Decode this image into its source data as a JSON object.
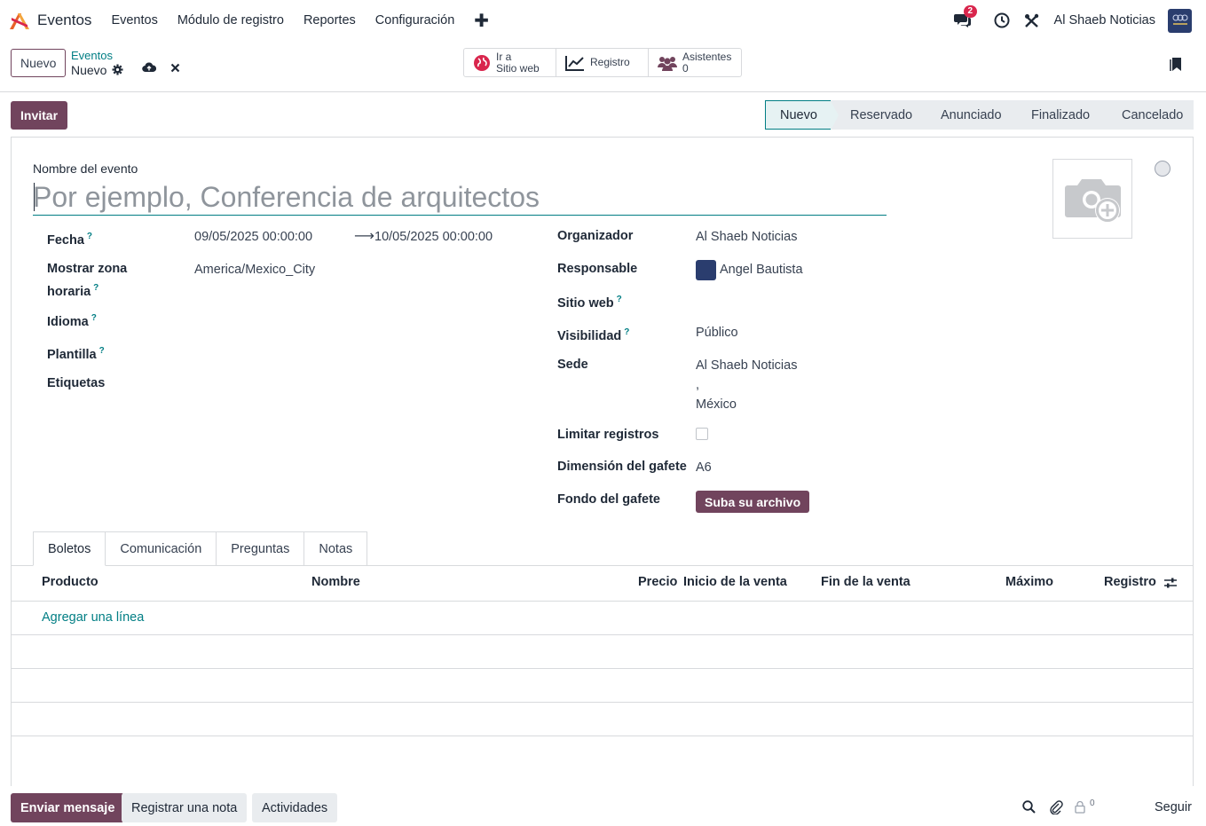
{
  "app": {
    "name": "Eventos"
  },
  "menu": {
    "items": [
      "Eventos",
      "Módulo de registro",
      "Reportes",
      "Configuración"
    ],
    "plus": "✚"
  },
  "navbar": {
    "messages_badge": "2",
    "company": "Al Shaeb Noticias"
  },
  "control": {
    "new_label": "Nuevo",
    "breadcrumb_parent": "Eventos",
    "breadcrumb_current": "Nuevo",
    "smart_buttons": {
      "website_line1": "Ir a",
      "website_line2": "Sitio web",
      "registration": "Registro",
      "attendees_label": "Asistentes",
      "attendees_count": "0"
    }
  },
  "statusbar": {
    "invite_label": "Invitar",
    "stages": [
      "Nuevo",
      "Reservado",
      "Anunciado",
      "Finalizado",
      "Cancelado"
    ],
    "active_stage": "Nuevo"
  },
  "form": {
    "event_name_label": "Nombre del evento",
    "event_name_placeholder": "Por ejemplo, Conferencia de arquitectos",
    "date_label": "Fecha",
    "date_start": "09/05/2025 00:00:00",
    "date_arrow": "⟶",
    "date_end": "10/05/2025 00:00:00",
    "timezone_label_line1": "Mostrar zona",
    "timezone_label_line2": "horaria",
    "timezone_value": "America/Mexico_City",
    "language_label": "Idioma",
    "template_label": "Plantilla",
    "tags_label": "Etiquetas",
    "organizer_label": "Organizador",
    "organizer_value": "Al Shaeb Noticias",
    "responsible_label": "Responsable",
    "responsible_value": "Angel Bautista",
    "website_label": "Sitio web",
    "visibility_label": "Visibilidad",
    "visibility_value": "Público",
    "venue_label": "Sede",
    "venue_line1": "Al Shaeb Noticias",
    "venue_line2": ",",
    "venue_line3": "México",
    "limit_label": "Limitar registros",
    "limit_checked": false,
    "badge_size_label": "Dimensión del gafete",
    "badge_size_value": "A6",
    "badge_bg_label": "Fondo del gafete",
    "upload_label": "Suba su archivo",
    "help_mark": "?"
  },
  "tabs": {
    "items": [
      "Boletos",
      "Comunicación",
      "Preguntas",
      "Notas"
    ],
    "active": "Boletos"
  },
  "tickets": {
    "columns": [
      "Producto",
      "Nombre",
      "Precio",
      "Inicio de la venta",
      "Fin de la venta",
      "Máximo",
      "Registro"
    ],
    "add_line": "Agregar una línea"
  },
  "chatter": {
    "send_message": "Enviar mensaje",
    "log_note": "Registrar una nota",
    "activities": "Actividades",
    "followers_count": "0",
    "follow": "Seguir"
  },
  "colors": {
    "primary": "#71445d",
    "accent": "#017e84",
    "badge": "#d9264d"
  }
}
